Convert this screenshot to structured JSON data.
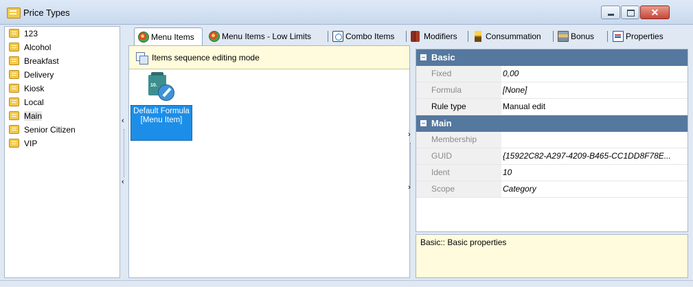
{
  "window": {
    "title": "Price Types"
  },
  "price_types": [
    "123",
    "Alcohol",
    "Breakfast",
    "Delivery",
    "Kiosk",
    "Local",
    "Main",
    "Senior Citizen",
    "VIP"
  ],
  "selected_price_type": "Main",
  "tabs": [
    {
      "label": "Menu Items",
      "icon": "menu-items-icon",
      "active": true
    },
    {
      "label": "Menu Items - Low Limits",
      "icon": "menu-items-icon",
      "active": false
    },
    {
      "label": "Combo Items",
      "icon": "combo-icon",
      "active": false
    },
    {
      "label": "Modifiers",
      "icon": "modifiers-icon",
      "active": false
    },
    {
      "label": "Consummation",
      "icon": "consummation-icon",
      "active": false
    },
    {
      "label": "Bonus",
      "icon": "bonus-icon",
      "active": false
    },
    {
      "label": "Properties",
      "icon": "properties-icon",
      "active": false
    }
  ],
  "mode_bar": {
    "text": "Items sequence editing mode"
  },
  "item": {
    "icon_badge": "10.",
    "label": "Default Formula [Menu Item]"
  },
  "properties": {
    "basic": {
      "title": "Basic",
      "rows": [
        {
          "name": "Fixed",
          "value": "0,00"
        },
        {
          "name": "Formula",
          "value": "[None]"
        },
        {
          "name": "Rule type",
          "value": "Manual edit"
        }
      ]
    },
    "main": {
      "title": "Main",
      "rows": [
        {
          "name": "Membership",
          "value": ""
        },
        {
          "name": "GUID",
          "value": "{15922C82-A297-4209-B465-CC1DD8F78E..."
        },
        {
          "name": "Ident",
          "value": "10"
        },
        {
          "name": "Scope",
          "value": "Category"
        }
      ]
    }
  },
  "description": "Basic:: Basic properties",
  "colors": {
    "category_header": "#55789f",
    "selected_tile": "#1c8ee8",
    "info_bar": "#fffbdc"
  }
}
